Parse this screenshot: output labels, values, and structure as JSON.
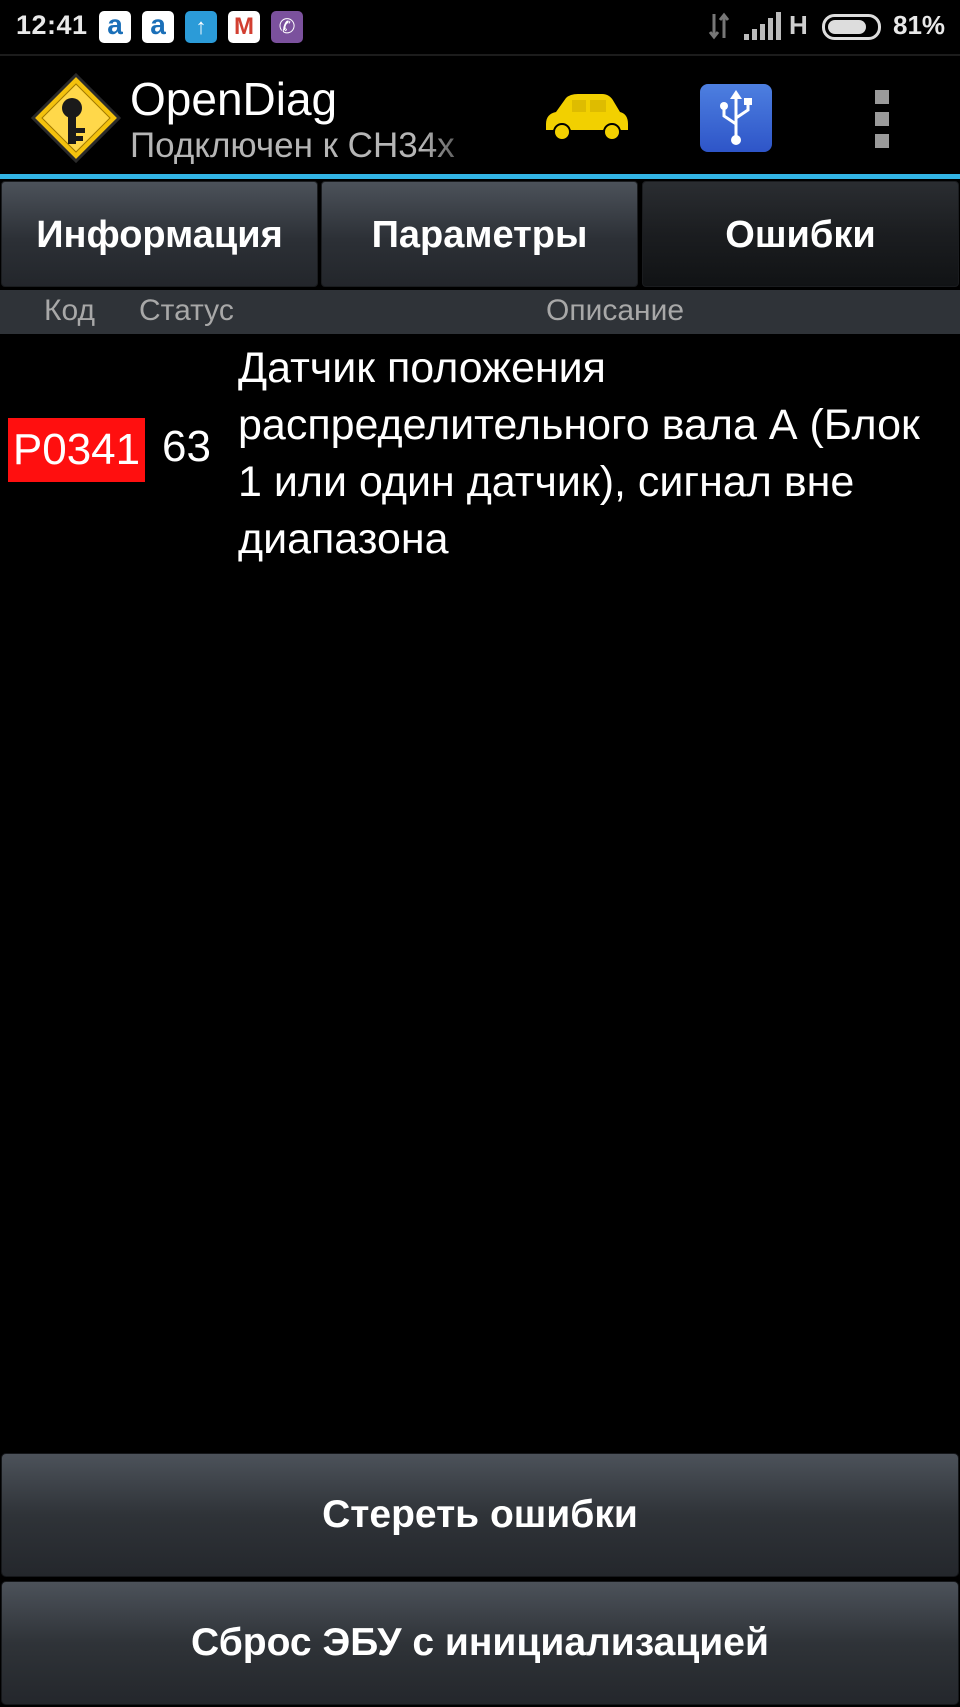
{
  "status_bar": {
    "time": "12:41",
    "network_type": "H",
    "battery_percent": "81%",
    "notification_icons": [
      "aliexpress-icon",
      "aliexpress-icon",
      "upload-icon",
      "gmail-icon",
      "viber-icon"
    ]
  },
  "action_bar": {
    "title": "OpenDiag",
    "subtitle": "Подключен к CH34x",
    "icons": [
      "app-logo-icon",
      "car-icon",
      "usb-icon",
      "overflow-menu-icon"
    ],
    "accent_color": "#33b5e5"
  },
  "tabs": [
    {
      "label": "Информация",
      "active": false
    },
    {
      "label": "Параметры",
      "active": false
    },
    {
      "label": "Ошибки",
      "active": true
    }
  ],
  "columns": {
    "code": "Код",
    "status": "Статус",
    "description": "Описание"
  },
  "errors": [
    {
      "code": "P0341",
      "status": "63",
      "description": "Датчик положения распределительного вала А (Блок 1 или один датчик), сигнал вне диапазона",
      "code_color": "#ff0f0f"
    }
  ],
  "buttons": {
    "clear_errors": "Стереть ошибки",
    "reset_ecu": "Сброс ЭБУ с инициализацией"
  }
}
